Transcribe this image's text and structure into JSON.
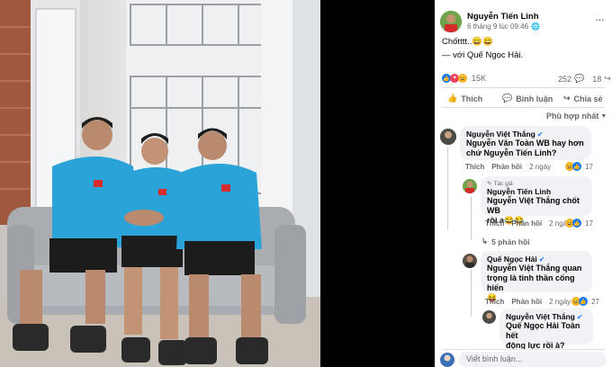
{
  "post": {
    "author": "Nguyễn Tiến Linh",
    "time": "6 tháng 9 lúc 09:46",
    "text": "Chốtttt..😄😄",
    "tag_text": "— với Quế Ngọc Hải.",
    "reactions_count": "15K",
    "comments_count": "252",
    "shares_count": "18"
  },
  "actions": {
    "like": "Thích",
    "comment": "Bình luận",
    "share": "Chia sẻ"
  },
  "sort_label": "Phù hợp nhất",
  "comments": [
    {
      "author": "Nguyễn Việt Thắng",
      "text_line1": "Nguyễn Văn Toàn WB hay hơn",
      "text_line2": "chứ Nguyễn Tiến Linh?",
      "like": "Thích",
      "reply": "Phản hồi",
      "time": "2 ngày",
      "react_count": "17"
    },
    {
      "badge": "Tác giả",
      "author": "Nguyễn Tiến Linh",
      "text_line1": "Nguyễn Việt Thắng chốt WB",
      "text_line2": "rồi a😂😂",
      "like": "Thích",
      "reply": "Phản hồi",
      "time": "2 ngày",
      "react_count": "17",
      "replies_label": "5 phản hồi"
    },
    {
      "author": "Quế Ngọc Hải",
      "text_line1": "Nguyễn Việt Thắng quan",
      "text_line2": "trọng là tinh thần cống hiến",
      "text_line3": "😝",
      "like": "Thích",
      "reply": "Phản hồi",
      "time": "2 ngày",
      "react_count": "27"
    },
    {
      "author": "Nguyễn Việt Thắng",
      "text_line1": "Quế Ngọc Hải Toàn hết",
      "text_line2": "động lực rồi à?"
    }
  ],
  "composer_placeholder": "Viết bình luận...",
  "colors": {
    "brand_blue": "#1877f2",
    "bubble": "#f0f2f5",
    "muted": "#65676b"
  }
}
